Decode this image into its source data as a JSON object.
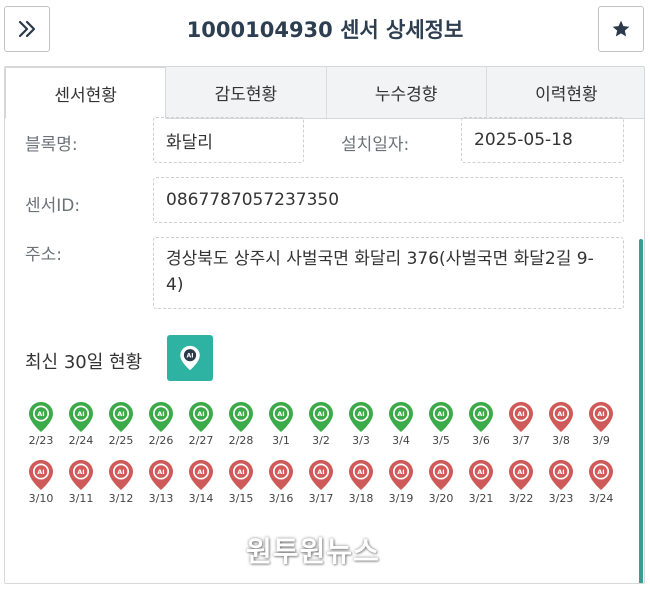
{
  "header": {
    "title": "1000104930 센서 상세정보",
    "expand_icon": "double-chevron-right-icon",
    "favorite_icon": "star-icon"
  },
  "tabs": [
    {
      "label": "센서현황",
      "active": true
    },
    {
      "label": "감도현황",
      "active": false
    },
    {
      "label": "누수경향",
      "active": false
    },
    {
      "label": "이력현황",
      "active": false
    }
  ],
  "info": {
    "block_label": "블록명:",
    "block_value": "화달리",
    "install_label": "설치일자:",
    "install_value": "2025-05-18",
    "sensor_label": "센서ID:",
    "sensor_value": "0867787057237350",
    "address_label": "주소:",
    "address_value": "경상북도 상주시 사벌국면 화달리 376(사벌국면 화달2길 9-4)"
  },
  "recent": {
    "title": "최신 30일 현황",
    "button_icon": "ai-location-pin-icon"
  },
  "colors": {
    "ok": "#3daa4a",
    "alert": "#cf5a5a",
    "accent": "#2eb3a3",
    "title": "#2c3e50"
  },
  "days": [
    {
      "date": "2/23",
      "status": "ok"
    },
    {
      "date": "2/24",
      "status": "ok"
    },
    {
      "date": "2/25",
      "status": "ok"
    },
    {
      "date": "2/26",
      "status": "ok"
    },
    {
      "date": "2/27",
      "status": "ok"
    },
    {
      "date": "2/28",
      "status": "ok"
    },
    {
      "date": "3/1",
      "status": "ok"
    },
    {
      "date": "3/2",
      "status": "ok"
    },
    {
      "date": "3/3",
      "status": "ok"
    },
    {
      "date": "3/4",
      "status": "ok"
    },
    {
      "date": "3/5",
      "status": "ok"
    },
    {
      "date": "3/6",
      "status": "ok"
    },
    {
      "date": "3/7",
      "status": "alert"
    },
    {
      "date": "3/8",
      "status": "alert"
    },
    {
      "date": "3/9",
      "status": "alert"
    },
    {
      "date": "3/10",
      "status": "alert"
    },
    {
      "date": "3/11",
      "status": "alert"
    },
    {
      "date": "3/12",
      "status": "alert"
    },
    {
      "date": "3/13",
      "status": "alert"
    },
    {
      "date": "3/14",
      "status": "alert"
    },
    {
      "date": "3/15",
      "status": "alert"
    },
    {
      "date": "3/16",
      "status": "alert"
    },
    {
      "date": "3/17",
      "status": "alert"
    },
    {
      "date": "3/18",
      "status": "alert"
    },
    {
      "date": "3/19",
      "status": "alert"
    },
    {
      "date": "3/20",
      "status": "alert"
    },
    {
      "date": "3/21",
      "status": "alert"
    },
    {
      "date": "3/22",
      "status": "alert"
    },
    {
      "date": "3/23",
      "status": "alert"
    },
    {
      "date": "3/24",
      "status": "alert"
    }
  ],
  "pin_text": "AI",
  "watermark": "원투원뉴스"
}
